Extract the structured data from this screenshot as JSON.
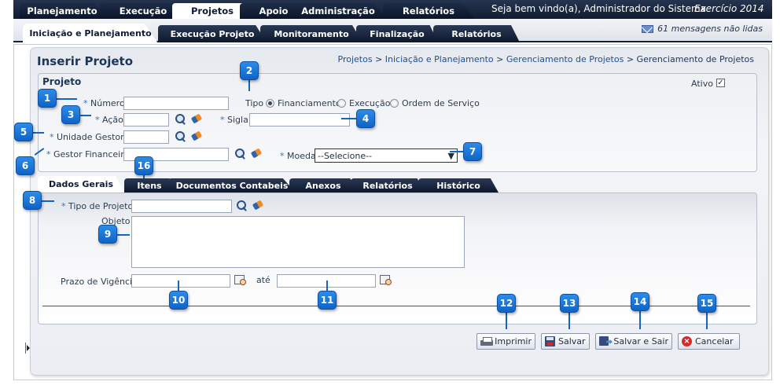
{
  "top_nav": {
    "tabs": [
      "Planejamento",
      "Execução",
      "Projetos",
      "Apoio",
      "Administração",
      "Relatórios"
    ],
    "active": "Projetos",
    "welcome": "Seja bem vindo(a), Administrador do Sistema",
    "exercicio": "Exercício 2014"
  },
  "sub_nav": {
    "tabs": [
      "Iniciação e Planejamento",
      "Execução Projeto",
      "Monitoramento",
      "Finalização",
      "Relatórios"
    ],
    "active": "Iniciação e Planejamento",
    "messages": "61 mensagens não lidas"
  },
  "page": {
    "title": "Inserir Projeto",
    "breadcrumb_links": [
      "Projetos",
      "Iniciação e Planejamento",
      "Gerenciamento de Projetos"
    ],
    "breadcrumb_current": "Gerenciamento de Projetos",
    "breadcrumb_sep": ">"
  },
  "projeto": {
    "heading": "Projeto",
    "ativo_label": "Ativo",
    "ativo_checked": true,
    "numero_label": "Número",
    "acao_label": "Ação",
    "unidade_label": "Unidade Gestora",
    "gestor_label": "Gestor Financeiro",
    "tipo_label": "Tipo",
    "tipo_options": [
      "Financiamento",
      "Execução",
      "Ordem de Serviço"
    ],
    "tipo_selected": "Financiamento",
    "sigla_label": "Sigla",
    "moeda_label": "Moeda",
    "moeda_value": "--Selecione--",
    "required_mark": "*"
  },
  "inner_tabs": {
    "tabs": [
      "Dados Gerais",
      "Itens",
      "Documentos Contabeis",
      "Anexos",
      "Relatórios",
      "Histórico"
    ],
    "active": "Dados Gerais"
  },
  "dados_gerais": {
    "tipo_projeto_label": "Tipo de Projeto",
    "objeto_label": "Objeto",
    "prazo_label": "Prazo de Vigência",
    "ate_label": "até"
  },
  "actions": {
    "imprimir": "Imprimir",
    "salvar": "Salvar",
    "salvar_sair": "Salvar e Sair",
    "cancelar": "Cancelar"
  },
  "callouts": [
    "1",
    "2",
    "3",
    "4",
    "5",
    "6",
    "7",
    "8",
    "9",
    "10",
    "11",
    "12",
    "13",
    "14",
    "15",
    "16"
  ],
  "colors": {
    "nav_dark": "#0f1c33",
    "callout_blue": "#1a78d8",
    "link_blue": "#1e4f8c",
    "cancel_red": "#d22b2b"
  },
  "icons": {
    "lookup": "search-icon",
    "clear": "eraser-icon",
    "date": "calendar-icon",
    "mail": "mail-icon",
    "print": "printer-icon",
    "save": "floppy-icon",
    "save_exit": "save-exit-icon",
    "cancel": "cancel-icon"
  }
}
